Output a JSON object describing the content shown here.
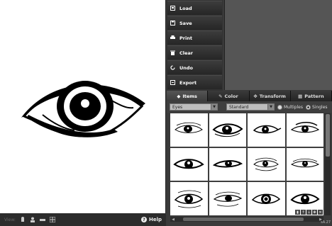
{
  "menu": {
    "items": [
      {
        "label": "Load",
        "icon": "load-icon"
      },
      {
        "label": "Save",
        "icon": "save-icon"
      },
      {
        "label": "Print",
        "icon": "print-icon"
      },
      {
        "label": "Clear",
        "icon": "trash-icon"
      },
      {
        "label": "Undo",
        "icon": "undo-icon"
      },
      {
        "label": "Export",
        "icon": "export-icon"
      }
    ]
  },
  "tabs": [
    {
      "label": "Items",
      "icon": "items-icon",
      "active": true
    },
    {
      "label": "Color",
      "icon": "brush-icon",
      "active": false
    },
    {
      "label": "Transform",
      "icon": "transform-icon",
      "active": false
    },
    {
      "label": "Pattern",
      "icon": "pattern-icon",
      "active": false
    }
  ],
  "selectors": {
    "category": "Eyes",
    "style": "Standard",
    "radio_multiples": "Multiples",
    "radio_singles": "Singles"
  },
  "bottom": {
    "view_label": "View:",
    "help_label": "Help"
  },
  "version": "sA.27"
}
